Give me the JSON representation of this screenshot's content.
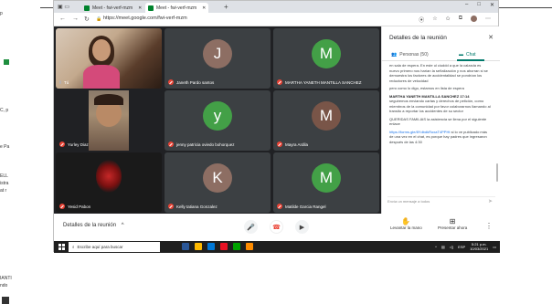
{
  "left_fragments": [
    "p",
    "C, p",
    "e Pa",
    "ELL",
    "istra",
    "at r",
    "IANTI",
    "ndo"
  ],
  "browser": {
    "tabs": [
      {
        "label": "Meet - fwi-verf-mzm",
        "active": false
      },
      {
        "label": "Meet - fwi-verf-mzm",
        "active": true
      }
    ],
    "new_tab": "+",
    "url": "https://meet.google.com/fwi-verf-mzm",
    "window_controls": [
      "–",
      "□",
      "✕"
    ]
  },
  "meet": {
    "tiles": [
      {
        "name": "Tú",
        "kind": "video",
        "muted": false
      },
      {
        "name": "Janeth Pardo santos",
        "initial": "J",
        "color": "#8d6e63",
        "muted": true
      },
      {
        "name": "MARTHA YANETH MANTILLA SANCHEZ",
        "initial": "M",
        "color": "#43a047",
        "muted": true
      },
      {
        "name": "Yurley Diaz",
        "kind": "video",
        "muted": true
      },
      {
        "name": "jenny patricia oviedo bohorquez",
        "initial": "y",
        "color": "#43a047",
        "muted": true
      },
      {
        "name": "Mayra Ardila",
        "initial": "M",
        "color": "#795548",
        "muted": true
      },
      {
        "name": "Yesid Pabon",
        "kind": "image",
        "muted": true
      },
      {
        "name": "Kelly tatiana Gonzalez",
        "initial": "K",
        "color": "#8d6e63",
        "muted": true
      },
      {
        "name": "Matilde Garcia Rangel",
        "initial": "M",
        "color": "#43a047",
        "muted": true
      }
    ],
    "details_label": "Detalles de la reunión",
    "raise_hand": "Levantar la mano",
    "present": "Presentar ahora"
  },
  "panel": {
    "title": "Detalles de la reunión",
    "tab_people": "Personas (50)",
    "tab_chat": "Chat",
    "messages": [
      {
        "sender": "",
        "text": "en sala de espera. En este ul ciuddd a que la calzada es nuevo primero nos harían la señalización y nos ahorran si se demuestra los factores de accidentalidad se pondrían los reductores de velocidad"
      },
      {
        "sender": "",
        "text": "pero como lo digo, estamos en lista de espera"
      },
      {
        "sender": "MARTHA YANETH MANTILLA SANCHEZ 17:14",
        "text": "seguiremos enviando cartas y derechos de petición, como miembros de la comunidad por favor colaborarnos llamando al transito a reportar los accidentes de su sector"
      },
      {
        "sender": "",
        "text": "QUERIDAS FAMILIAS la asistencia se llena por el siguiente enlace"
      },
      {
        "sender": "",
        "link": "https://forms.gle/8YdbdkRoxaT4PPHt",
        "text": "si lo ve publicado más de una vez en el chat, es porque hay padres que ingresaron después de las 4:30"
      }
    ],
    "input_placeholder": "Envía un mensaje a todos"
  },
  "taskbar": {
    "search_placeholder": "Escribe aquí para buscar",
    "language": "ESP",
    "time": "5:21 p.m.",
    "date": "10/03/2021",
    "app_colors": [
      "#2b5797",
      "#ffb900",
      "#0078d7",
      "#e81123",
      "#00a300",
      "#ff8c00"
    ]
  }
}
